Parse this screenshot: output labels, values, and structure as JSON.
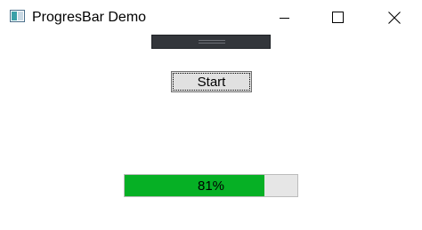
{
  "window": {
    "title": "ProgresBar Demo",
    "icon": "app-window-icon",
    "controls": [
      "minimize-icon",
      "maximize-icon",
      "close-icon"
    ]
  },
  "start_button": {
    "label": "Start"
  },
  "progress": {
    "value": 0.81,
    "label": "81%",
    "fill_color": "#06b025",
    "track_color": "#e6e6e6"
  }
}
